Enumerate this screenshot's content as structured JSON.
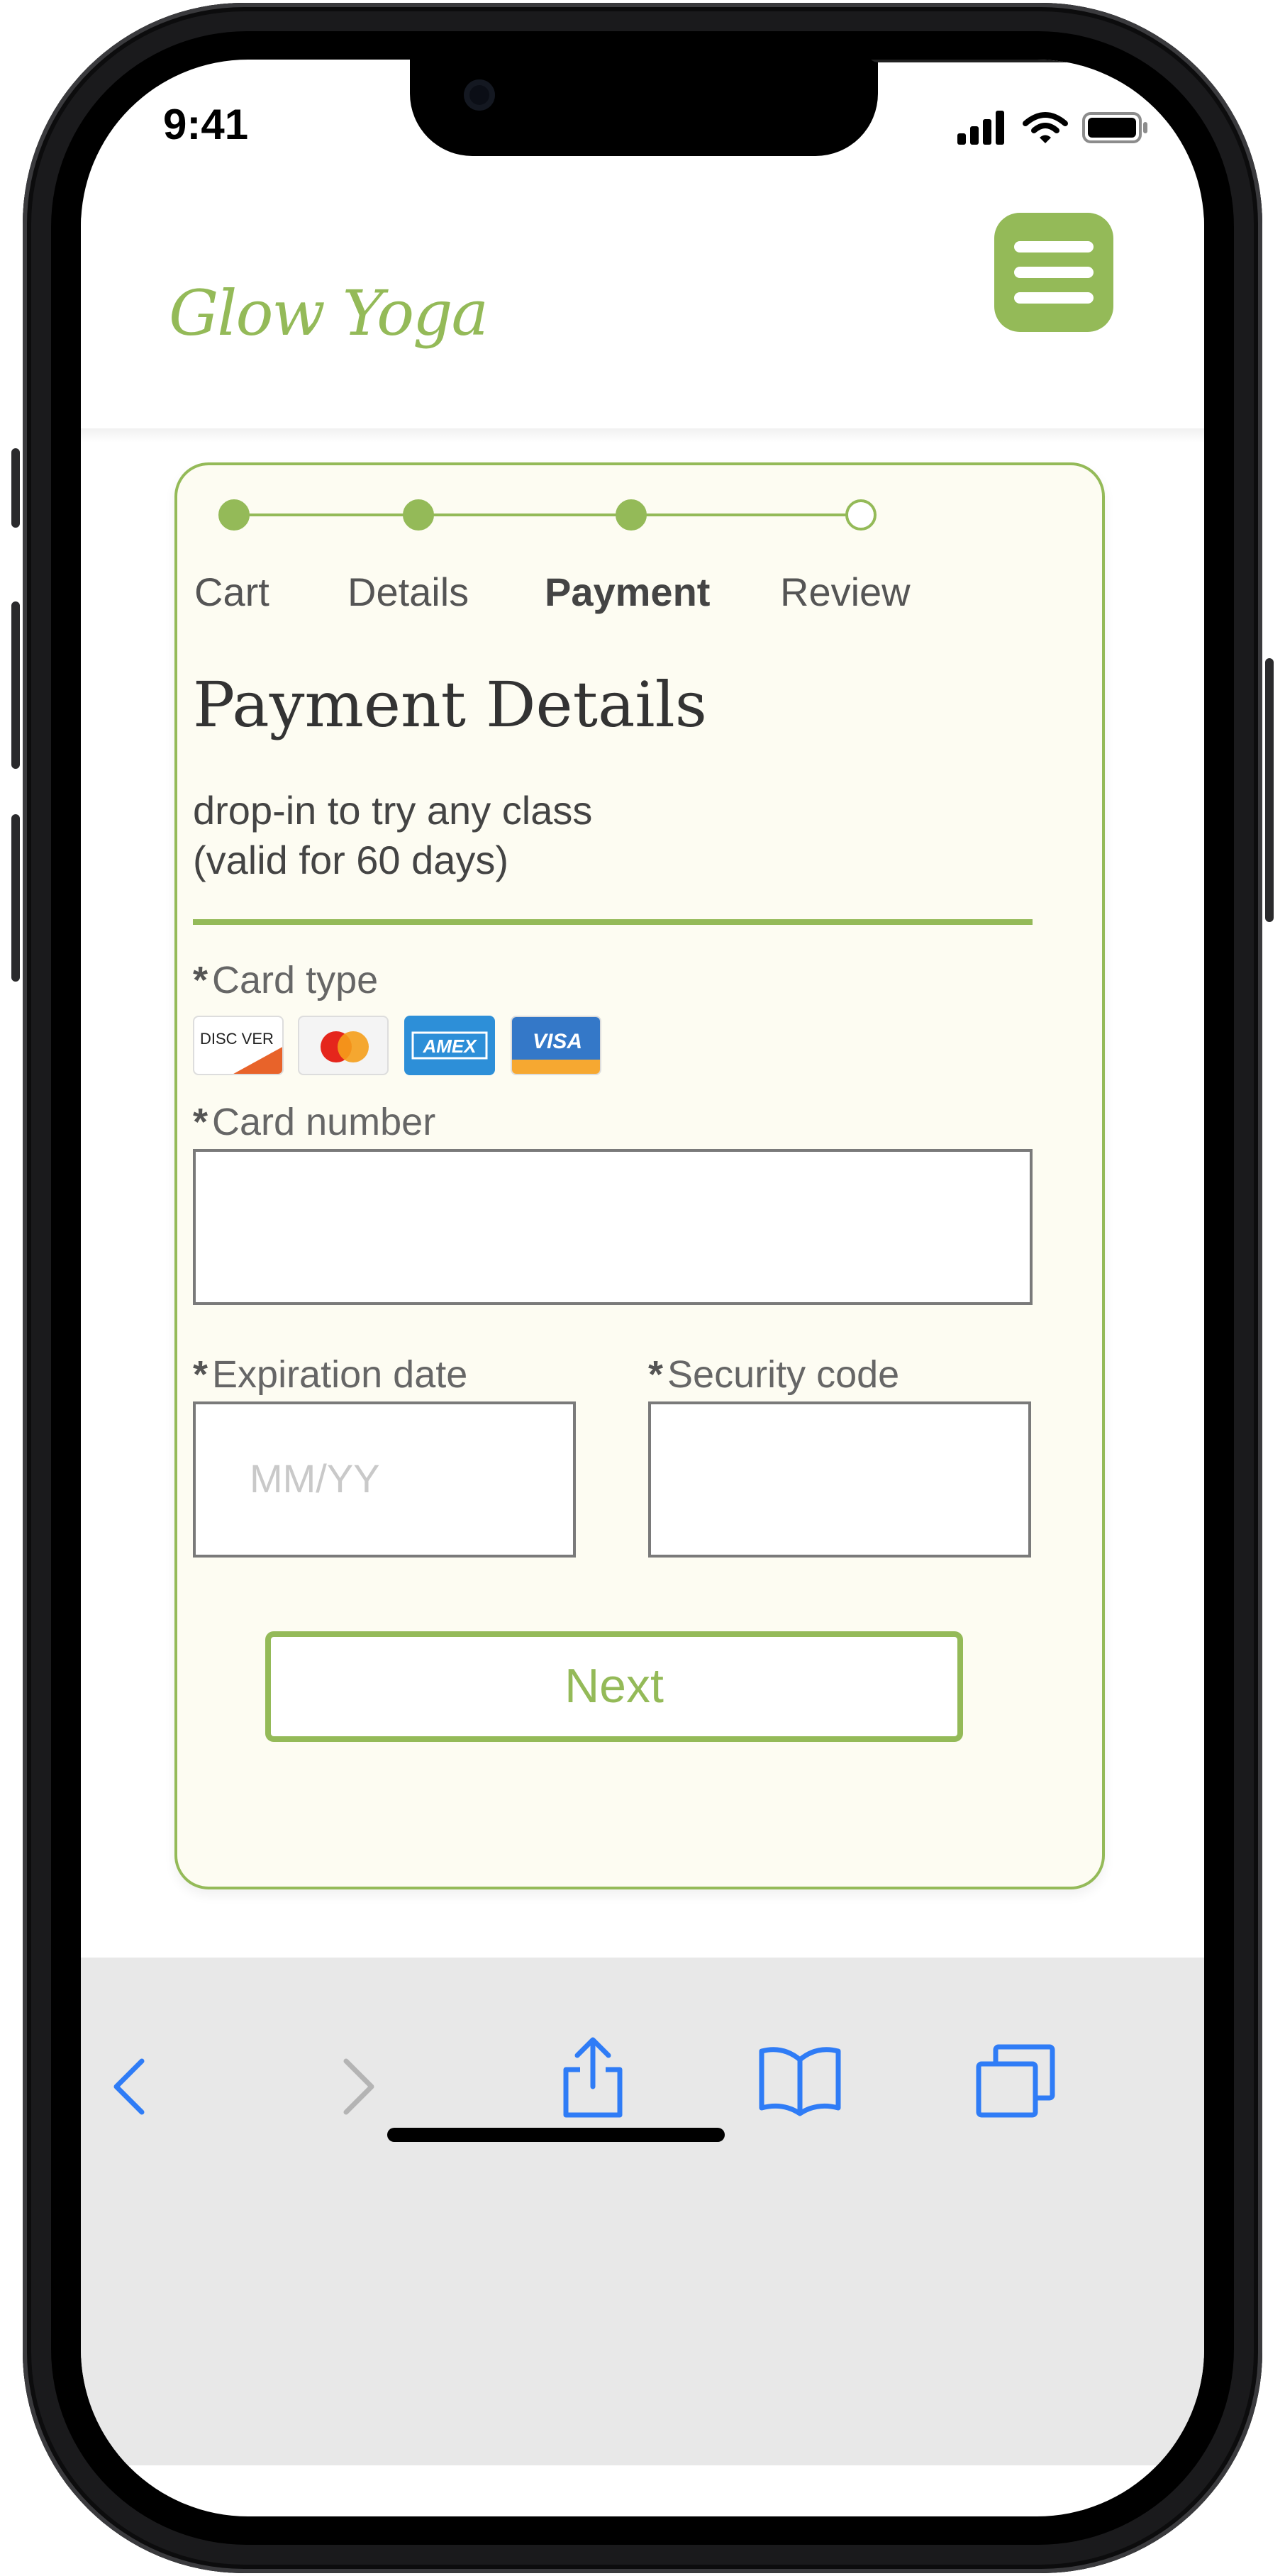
{
  "status_bar": {
    "time": "9:41"
  },
  "header": {
    "logo": "Glow Yoga",
    "menu_icon": "hamburger-menu-icon"
  },
  "checkout": {
    "steps": [
      {
        "label": "Cart",
        "state": "complete"
      },
      {
        "label": "Details",
        "state": "complete"
      },
      {
        "label": "Payment",
        "state": "current"
      },
      {
        "label": "Review",
        "state": "pending"
      }
    ],
    "title": "Payment Details",
    "description_line1": "drop-in to try any class",
    "description_line2": "(valid for 60 days)",
    "required_marker": "*",
    "card_type_label": "Card type",
    "card_types": [
      {
        "name": "discover-card-icon",
        "text": "DISC VER"
      },
      {
        "name": "mastercard-icon",
        "text": ""
      },
      {
        "name": "amex-card-icon",
        "text": "AMEX"
      },
      {
        "name": "visa-card-icon",
        "text": "VISA"
      }
    ],
    "card_number_label": "Card number",
    "card_number_value": "",
    "expiration_label": "Expiration date",
    "expiration_placeholder": "MM/YY",
    "security_code_label": "Security code",
    "security_code_value": "",
    "next_button": "Next"
  },
  "colors": {
    "accent": "#94ba58",
    "card_background": "#fdfcf2",
    "safari_blue": "#2f7cf6"
  },
  "browser_toolbar": {
    "icons": [
      "back-icon",
      "forward-icon",
      "share-icon",
      "bookmarks-icon",
      "tabs-icon"
    ]
  }
}
